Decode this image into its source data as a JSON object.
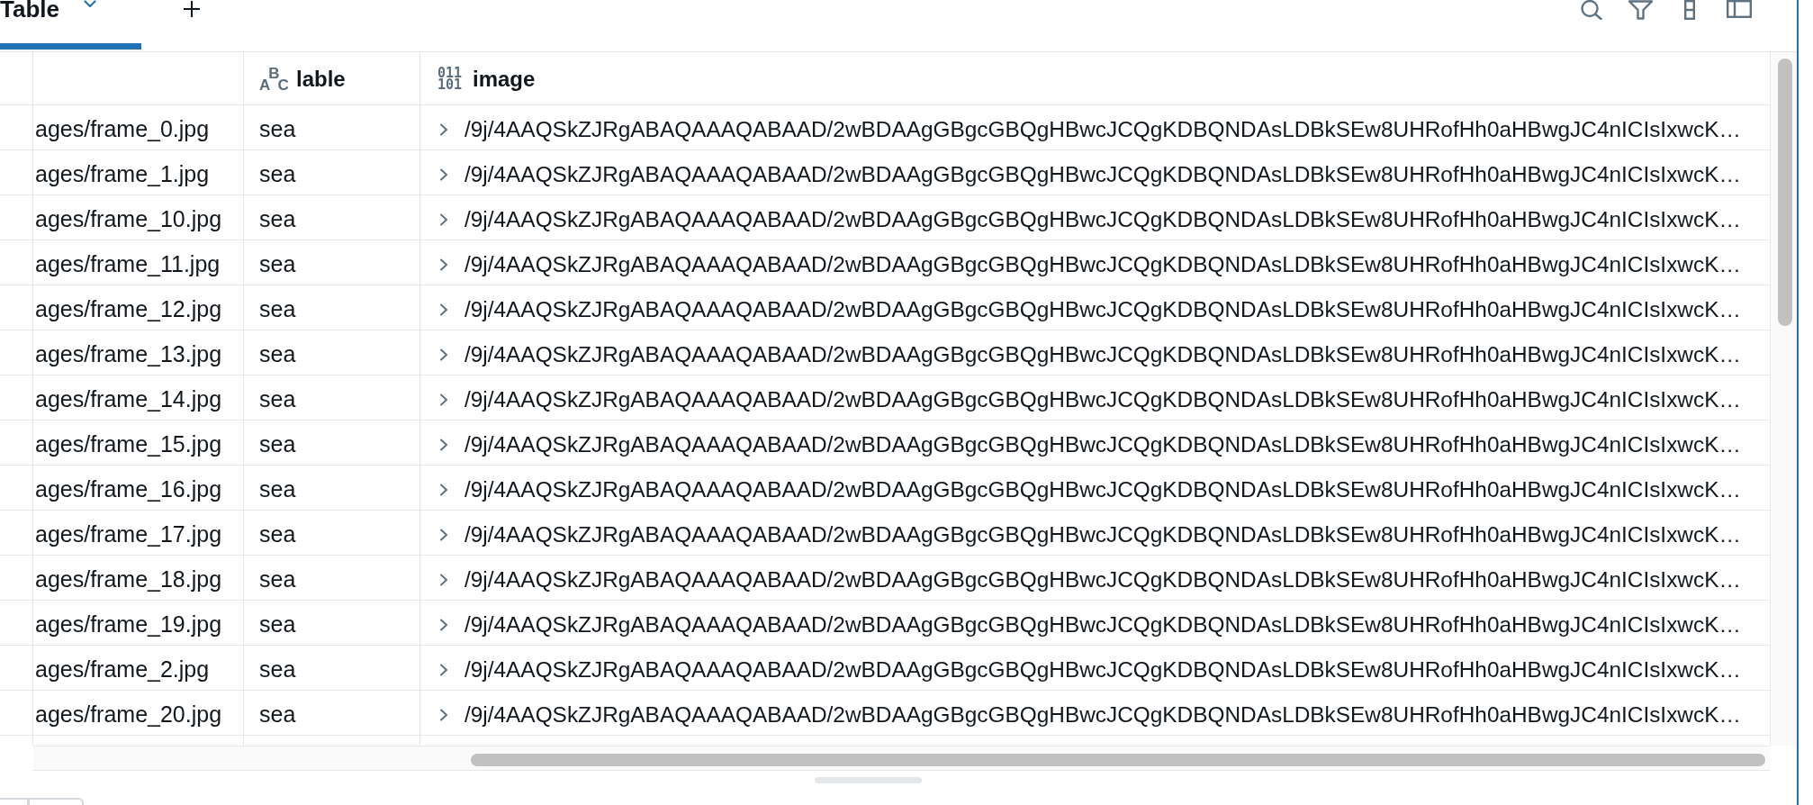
{
  "tabs": [
    {
      "label": "Table",
      "selected": true
    }
  ],
  "table": {
    "columns": [
      {
        "kind": "plain"
      },
      {
        "kind": "string",
        "type_glyphs": [
          "A",
          "B",
          "C"
        ],
        "label": "lable"
      },
      {
        "kind": "binary",
        "type_glyphs": [
          "011",
          "101"
        ],
        "label": "image"
      }
    ],
    "rows": [
      {
        "cells": [
          "ages/frame_0.jpg",
          "sea",
          "/9j/4AAQSkZJRgABAQAAAQABAAD/2wBDAAgGBgcGBQgHBwcJCQgKDBQNDAsLDBkSEw8UHRofHh0aHBwgJC4nICIsIxwcK…"
        ],
        "expanded": false
      },
      {
        "cells": [
          "ages/frame_1.jpg",
          "sea",
          "/9j/4AAQSkZJRgABAQAAAQABAAD/2wBDAAgGBgcGBQgHBwcJCQgKDBQNDAsLDBkSEw8UHRofHh0aHBwgJC4nICIsIxwcK…"
        ],
        "expanded": false
      },
      {
        "cells": [
          "ages/frame_10.jpg",
          "sea",
          "/9j/4AAQSkZJRgABAQAAAQABAAD/2wBDAAgGBgcGBQgHBwcJCQgKDBQNDAsLDBkSEw8UHRofHh0aHBwgJC4nICIsIxwcK…"
        ],
        "expanded": false
      },
      {
        "cells": [
          "ages/frame_11.jpg",
          "sea",
          "/9j/4AAQSkZJRgABAQAAAQABAAD/2wBDAAgGBgcGBQgHBwcJCQgKDBQNDAsLDBkSEw8UHRofHh0aHBwgJC4nICIsIxwcK…"
        ],
        "expanded": false
      },
      {
        "cells": [
          "ages/frame_12.jpg",
          "sea",
          "/9j/4AAQSkZJRgABAQAAAQABAAD/2wBDAAgGBgcGBQgHBwcJCQgKDBQNDAsLDBkSEw8UHRofHh0aHBwgJC4nICIsIxwcK…"
        ],
        "expanded": false
      },
      {
        "cells": [
          "ages/frame_13.jpg",
          "sea",
          "/9j/4AAQSkZJRgABAQAAAQABAAD/2wBDAAgGBgcGBQgHBwcJCQgKDBQNDAsLDBkSEw8UHRofHh0aHBwgJC4nICIsIxwcK…"
        ],
        "expanded": false
      },
      {
        "cells": [
          "ages/frame_14.jpg",
          "sea",
          "/9j/4AAQSkZJRgABAQAAAQABAAD/2wBDAAgGBgcGBQgHBwcJCQgKDBQNDAsLDBkSEw8UHRofHh0aHBwgJC4nICIsIxwcK…"
        ],
        "expanded": false
      },
      {
        "cells": [
          "ages/frame_15.jpg",
          "sea",
          "/9j/4AAQSkZJRgABAQAAAQABAAD/2wBDAAgGBgcGBQgHBwcJCQgKDBQNDAsLDBkSEw8UHRofHh0aHBwgJC4nICIsIxwcK…"
        ],
        "expanded": false
      },
      {
        "cells": [
          "ages/frame_16.jpg",
          "sea",
          "/9j/4AAQSkZJRgABAQAAAQABAAD/2wBDAAgGBgcGBQgHBwcJCQgKDBQNDAsLDBkSEw8UHRofHh0aHBwgJC4nICIsIxwcK…"
        ],
        "expanded": false
      },
      {
        "cells": [
          "ages/frame_17.jpg",
          "sea",
          "/9j/4AAQSkZJRgABAQAAAQABAAD/2wBDAAgGBgcGBQgHBwcJCQgKDBQNDAsLDBkSEw8UHRofHh0aHBwgJC4nICIsIxwcK…"
        ],
        "expanded": false
      },
      {
        "cells": [
          "ages/frame_18.jpg",
          "sea",
          "/9j/4AAQSkZJRgABAQAAAQABAAD/2wBDAAgGBgcGBQgHBwcJCQgKDBQNDAsLDBkSEw8UHRofHh0aHBwgJC4nICIsIxwcK…"
        ],
        "expanded": false
      },
      {
        "cells": [
          "ages/frame_19.jpg",
          "sea",
          "/9j/4AAQSkZJRgABAQAAAQABAAD/2wBDAAgGBgcGBQgHBwcJCQgKDBQNDAsLDBkSEw8UHRofHh0aHBwgJC4nICIsIxwcK…"
        ],
        "expanded": false
      },
      {
        "cells": [
          "ages/frame_2.jpg",
          "sea",
          "/9j/4AAQSkZJRgABAQAAAQABAAD/2wBDAAgGBgcGBQgHBwcJCQgKDBQNDAsLDBkSEw8UHRofHh0aHBwgJC4nICIsIxwcK…"
        ],
        "expanded": false
      },
      {
        "cells": [
          "ages/frame_20.jpg",
          "sea",
          "/9j/4AAQSkZJRgABAQAAAQABAAD/2wBDAAgGBgcGBQgHBwcJCQgKDBQNDAsLDBkSEw8UHRofHh0aHBwgJC4nICIsIxwcK…"
        ],
        "expanded": false
      }
    ]
  }
}
